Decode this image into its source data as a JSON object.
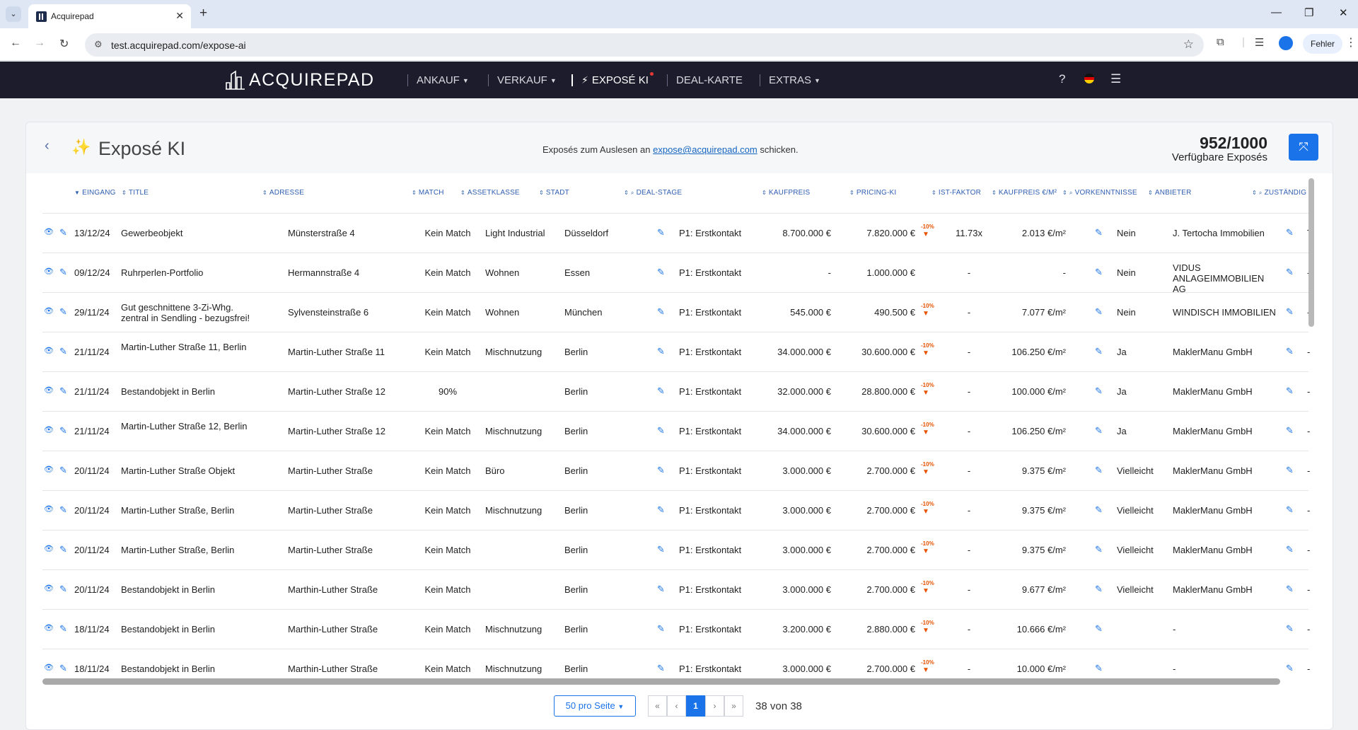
{
  "browser": {
    "tab_title": "Acquirepad",
    "url": "test.acquirepad.com/expose-ai",
    "error_label": "Fehler"
  },
  "app": {
    "logo_text": "ACQUIREPAD",
    "menu": [
      {
        "label": "ANKAUF",
        "has_caret": true
      },
      {
        "label": "VERKAUF",
        "has_caret": true
      },
      {
        "label": "EXPOSÉ KI",
        "has_caret": false,
        "active": true
      },
      {
        "label": "DEAL-KARTE",
        "has_caret": false
      },
      {
        "label": "EXTRAS",
        "has_caret": true
      }
    ],
    "help_label": "?"
  },
  "page": {
    "title": "Exposé KI",
    "hint_prefix": "Exposés zum Auslesen an",
    "hint_email": "expose@acquirepad.com",
    "hint_suffix": "schicken.",
    "counter": "952/1000",
    "counter_label": "Verfügbare Exposés"
  },
  "table": {
    "headers": [
      "EINGANG",
      "TITLE",
      "ADRESSE",
      "MATCH",
      "ASSETKLASSE",
      "STADT",
      "DEAL-STAGE",
      "KAUFPREIS",
      "PRICING-KI",
      "IST-FAKTOR",
      "KAUFPREIS €/M²",
      "VORKENNTNISSE",
      "ANBIETER",
      "ZUSTÄNDIG"
    ],
    "rows": [
      {
        "date": "13/12/24",
        "title": "Gewerbeobjekt",
        "address": "Münsterstraße 4",
        "match": "Kein Match",
        "asset": "Light Industrial",
        "city": "Düsseldorf",
        "stage": "P1: Erstkontakt",
        "price": "8.700.000 €",
        "pricing": "7.820.000 €",
        "pricing_badge": "-10%",
        "factor": "11.73x",
        "sqm": "2.013 €/m²",
        "prior": "Nein",
        "provider": "J. Tertocha Immobilien",
        "owner": "Theo W"
      },
      {
        "date": "09/12/24",
        "title": "Ruhrperlen-Portfolio",
        "address": "Hermannstraße 4",
        "match": "Kein Match",
        "asset": "Wohnen",
        "city": "Essen",
        "stage": "P1: Erstkontakt",
        "price": "-",
        "pricing": "1.000.000 €",
        "pricing_badge": "",
        "factor": "-",
        "sqm": "-",
        "prior": "Nein",
        "provider": "VIDUS ANLAGEIMMOBILIEN AG",
        "owner": "-"
      },
      {
        "date": "29/11/24",
        "title": "Gut geschnittene 3-Zi-Whg. zentral in Sendling - bezugsfrei!",
        "address": "Sylvensteinstraße 6",
        "match": "Kein Match",
        "asset": "Wohnen",
        "city": "München",
        "stage": "P1: Erstkontakt",
        "price": "545.000 €",
        "pricing": "490.500 €",
        "pricing_badge": "-10%",
        "factor": "-",
        "sqm": "7.077 €/m²",
        "prior": "Nein",
        "provider": "WINDISCH IMMOBILIEN",
        "owner": "-"
      },
      {
        "date": "21/11/24",
        "title": "Martin-Luther Straße 11, Berlin",
        "address": "Martin-Luther Straße 11",
        "match": "Kein Match",
        "asset": "Mischnutzung",
        "city": "Berlin",
        "stage": "P1: Erstkontakt",
        "price": "34.000.000 €",
        "pricing": "30.600.000 €",
        "pricing_badge": "-10%",
        "factor": "-",
        "sqm": "106.250 €/m²",
        "prior": "Ja",
        "provider": "MaklerManu GmbH",
        "owner": "-"
      },
      {
        "date": "21/11/24",
        "title": "Bestandobjekt in Berlin",
        "address": "Martin-Luther Straße 12",
        "match": "90%",
        "asset": "",
        "city": "Berlin",
        "stage": "P1: Erstkontakt",
        "price": "32.000.000 €",
        "pricing": "28.800.000 €",
        "pricing_badge": "-10%",
        "factor": "-",
        "sqm": "100.000 €/m²",
        "prior": "Ja",
        "provider": "MaklerManu GmbH",
        "owner": "-"
      },
      {
        "date": "21/11/24",
        "title": "Martin-Luther Straße 12, Berlin",
        "address": "Martin-Luther Straße 12",
        "match": "Kein Match",
        "asset": "Mischnutzung",
        "city": "Berlin",
        "stage": "P1: Erstkontakt",
        "price": "34.000.000 €",
        "pricing": "30.600.000 €",
        "pricing_badge": "-10%",
        "factor": "-",
        "sqm": "106.250 €/m²",
        "prior": "Ja",
        "provider": "MaklerManu GmbH",
        "owner": "-"
      },
      {
        "date": "20/11/24",
        "title": "Martin-Luther Straße Objekt",
        "address": "Martin-Luther Straße",
        "match": "Kein Match",
        "asset": "Büro",
        "city": "Berlin",
        "stage": "P1: Erstkontakt",
        "price": "3.000.000 €",
        "pricing": "2.700.000 €",
        "pricing_badge": "-10%",
        "factor": "-",
        "sqm": "9.375 €/m²",
        "prior": "Vielleicht",
        "provider": "MaklerManu GmbH",
        "owner": "-"
      },
      {
        "date": "20/11/24",
        "title": "Martin-Luther Straße, Berlin",
        "address": "Martin-Luther Straße",
        "match": "Kein Match",
        "asset": "Mischnutzung",
        "city": "Berlin",
        "stage": "P1: Erstkontakt",
        "price": "3.000.000 €",
        "pricing": "2.700.000 €",
        "pricing_badge": "-10%",
        "factor": "-",
        "sqm": "9.375 €/m²",
        "prior": "Vielleicht",
        "provider": "MaklerManu GmbH",
        "owner": "-"
      },
      {
        "date": "20/11/24",
        "title": "Martin-Luther Straße, Berlin",
        "address": "Martin-Luther Straße",
        "match": "Kein Match",
        "asset": "",
        "city": "Berlin",
        "stage": "P1: Erstkontakt",
        "price": "3.000.000 €",
        "pricing": "2.700.000 €",
        "pricing_badge": "-10%",
        "factor": "-",
        "sqm": "9.375 €/m²",
        "prior": "Vielleicht",
        "provider": "MaklerManu GmbH",
        "owner": "-"
      },
      {
        "date": "20/11/24",
        "title": "Bestandobjekt in Berlin",
        "address": "Marthin-Luther Straße",
        "match": "Kein Match",
        "asset": "",
        "city": "Berlin",
        "stage": "P1: Erstkontakt",
        "price": "3.000.000 €",
        "pricing": "2.700.000 €",
        "pricing_badge": "-10%",
        "factor": "-",
        "sqm": "9.677 €/m²",
        "prior": "Vielleicht",
        "provider": "MaklerManu GmbH",
        "owner": "-"
      },
      {
        "date": "18/11/24",
        "title": "Bestandobjekt in Berlin",
        "address": "Marthin-Luther Straße",
        "match": "Kein Match",
        "asset": "Mischnutzung",
        "city": "Berlin",
        "stage": "P1: Erstkontakt",
        "price": "3.200.000 €",
        "pricing": "2.880.000 €",
        "pricing_badge": "-10%",
        "factor": "-",
        "sqm": "10.666 €/m²",
        "prior": "",
        "provider": "-",
        "owner": "-"
      },
      {
        "date": "18/11/24",
        "title": "Bestandobjekt in Berlin",
        "address": "Marthin-Luther Straße",
        "match": "Kein Match",
        "asset": "Mischnutzung",
        "city": "Berlin",
        "stage": "P1: Erstkontakt",
        "price": "3.000.000 €",
        "pricing": "2.700.000 €",
        "pricing_badge": "-10%",
        "factor": "-",
        "sqm": "10.000 €/m²",
        "prior": "",
        "provider": "-",
        "owner": "-"
      }
    ]
  },
  "pagination": {
    "per_page": "50 pro Seite",
    "first": "«",
    "prev": "‹",
    "current": "1",
    "next": "›",
    "last": "»",
    "count": "38 von 38"
  },
  "colors": {
    "accent": "#1a73e8",
    "header_bg": "#1c1c2c",
    "badge": "#e65100"
  }
}
